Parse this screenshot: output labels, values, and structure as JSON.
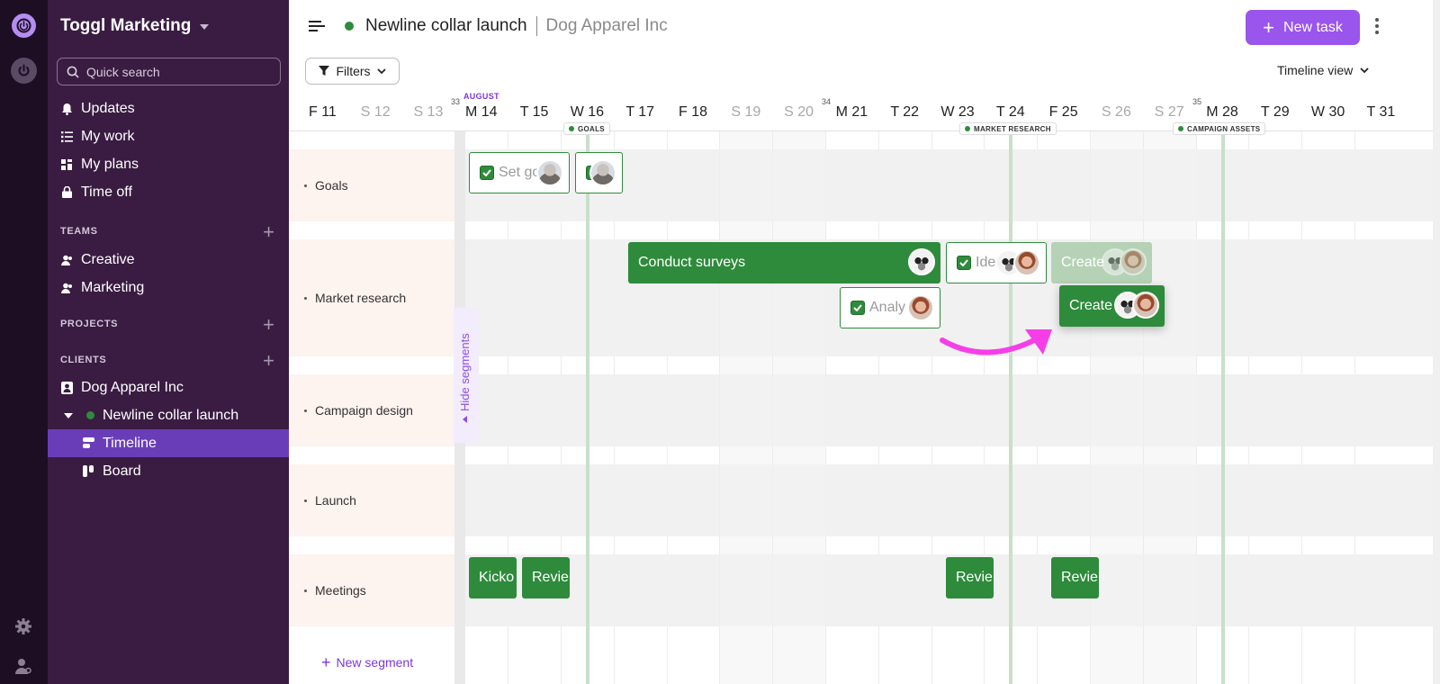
{
  "sidebar": {
    "workspace": "Toggl Marketing",
    "search_placeholder": "Quick search",
    "nav": [
      "Updates",
      "My work",
      "My plans",
      "Time off"
    ],
    "teams_header": "TEAMS",
    "teams": [
      "Creative",
      "Marketing"
    ],
    "projects_header": "PROJECTS",
    "clients_header": "CLIENTS",
    "client": "Dog Apparel Inc",
    "project": "Newline collar launch",
    "views": [
      "Timeline",
      "Board"
    ]
  },
  "header": {
    "project_name": "Newline collar launch",
    "client_name": "Dog Apparel Inc",
    "new_task_label": "New task",
    "filters_label": "Filters",
    "view_label": "Timeline view"
  },
  "timeline": {
    "month_label": "AUGUST",
    "week_numbers": [
      "33",
      "34",
      "35"
    ],
    "days": [
      {
        "label": "F 11",
        "weekend": false
      },
      {
        "label": "S 12",
        "weekend": true
      },
      {
        "label": "S 13",
        "weekend": true
      },
      {
        "label": "M 14",
        "weekend": false
      },
      {
        "label": "T 15",
        "weekend": false
      },
      {
        "label": "W 16",
        "weekend": false
      },
      {
        "label": "T 17",
        "weekend": false
      },
      {
        "label": "F 18",
        "weekend": false
      },
      {
        "label": "S 19",
        "weekend": true
      },
      {
        "label": "S 20",
        "weekend": true
      },
      {
        "label": "M 21",
        "weekend": false
      },
      {
        "label": "T 22",
        "weekend": false
      },
      {
        "label": "W 23",
        "weekend": false
      },
      {
        "label": "T 24",
        "weekend": false
      },
      {
        "label": "F 25",
        "weekend": false
      },
      {
        "label": "S 26",
        "weekend": true
      },
      {
        "label": "S 27",
        "weekend": true
      },
      {
        "label": "M 28",
        "weekend": false
      },
      {
        "label": "T 29",
        "weekend": false
      },
      {
        "label": "W 30",
        "weekend": false
      },
      {
        "label": "T 31",
        "weekend": false
      }
    ],
    "milestones": [
      "GOALS",
      "MARKET RESEARCH",
      "CAMPAIGN ASSETS"
    ],
    "segments": [
      "Goals",
      "Market research",
      "Campaign design",
      "Launch",
      "Meetings"
    ],
    "hide_segments_label": "Hide segments",
    "new_segment_label": "New segment",
    "tasks": {
      "set_goals": "Set go",
      "goals_2": "",
      "conduct_surveys": "Conduct surveys",
      "identify": "Ide",
      "create_ghost": "Create",
      "analyze": "Analy",
      "create_drag": "Create",
      "kickoff": "Kicko",
      "review_1": "Revie",
      "review_2": "Revie",
      "review_3": "Revie"
    }
  },
  "colors": {
    "accent": "#9a55ed",
    "sidebar_bg": "#3a1c42",
    "task_green": "#2e8b3b",
    "arrow_magenta": "#f53ee8"
  }
}
